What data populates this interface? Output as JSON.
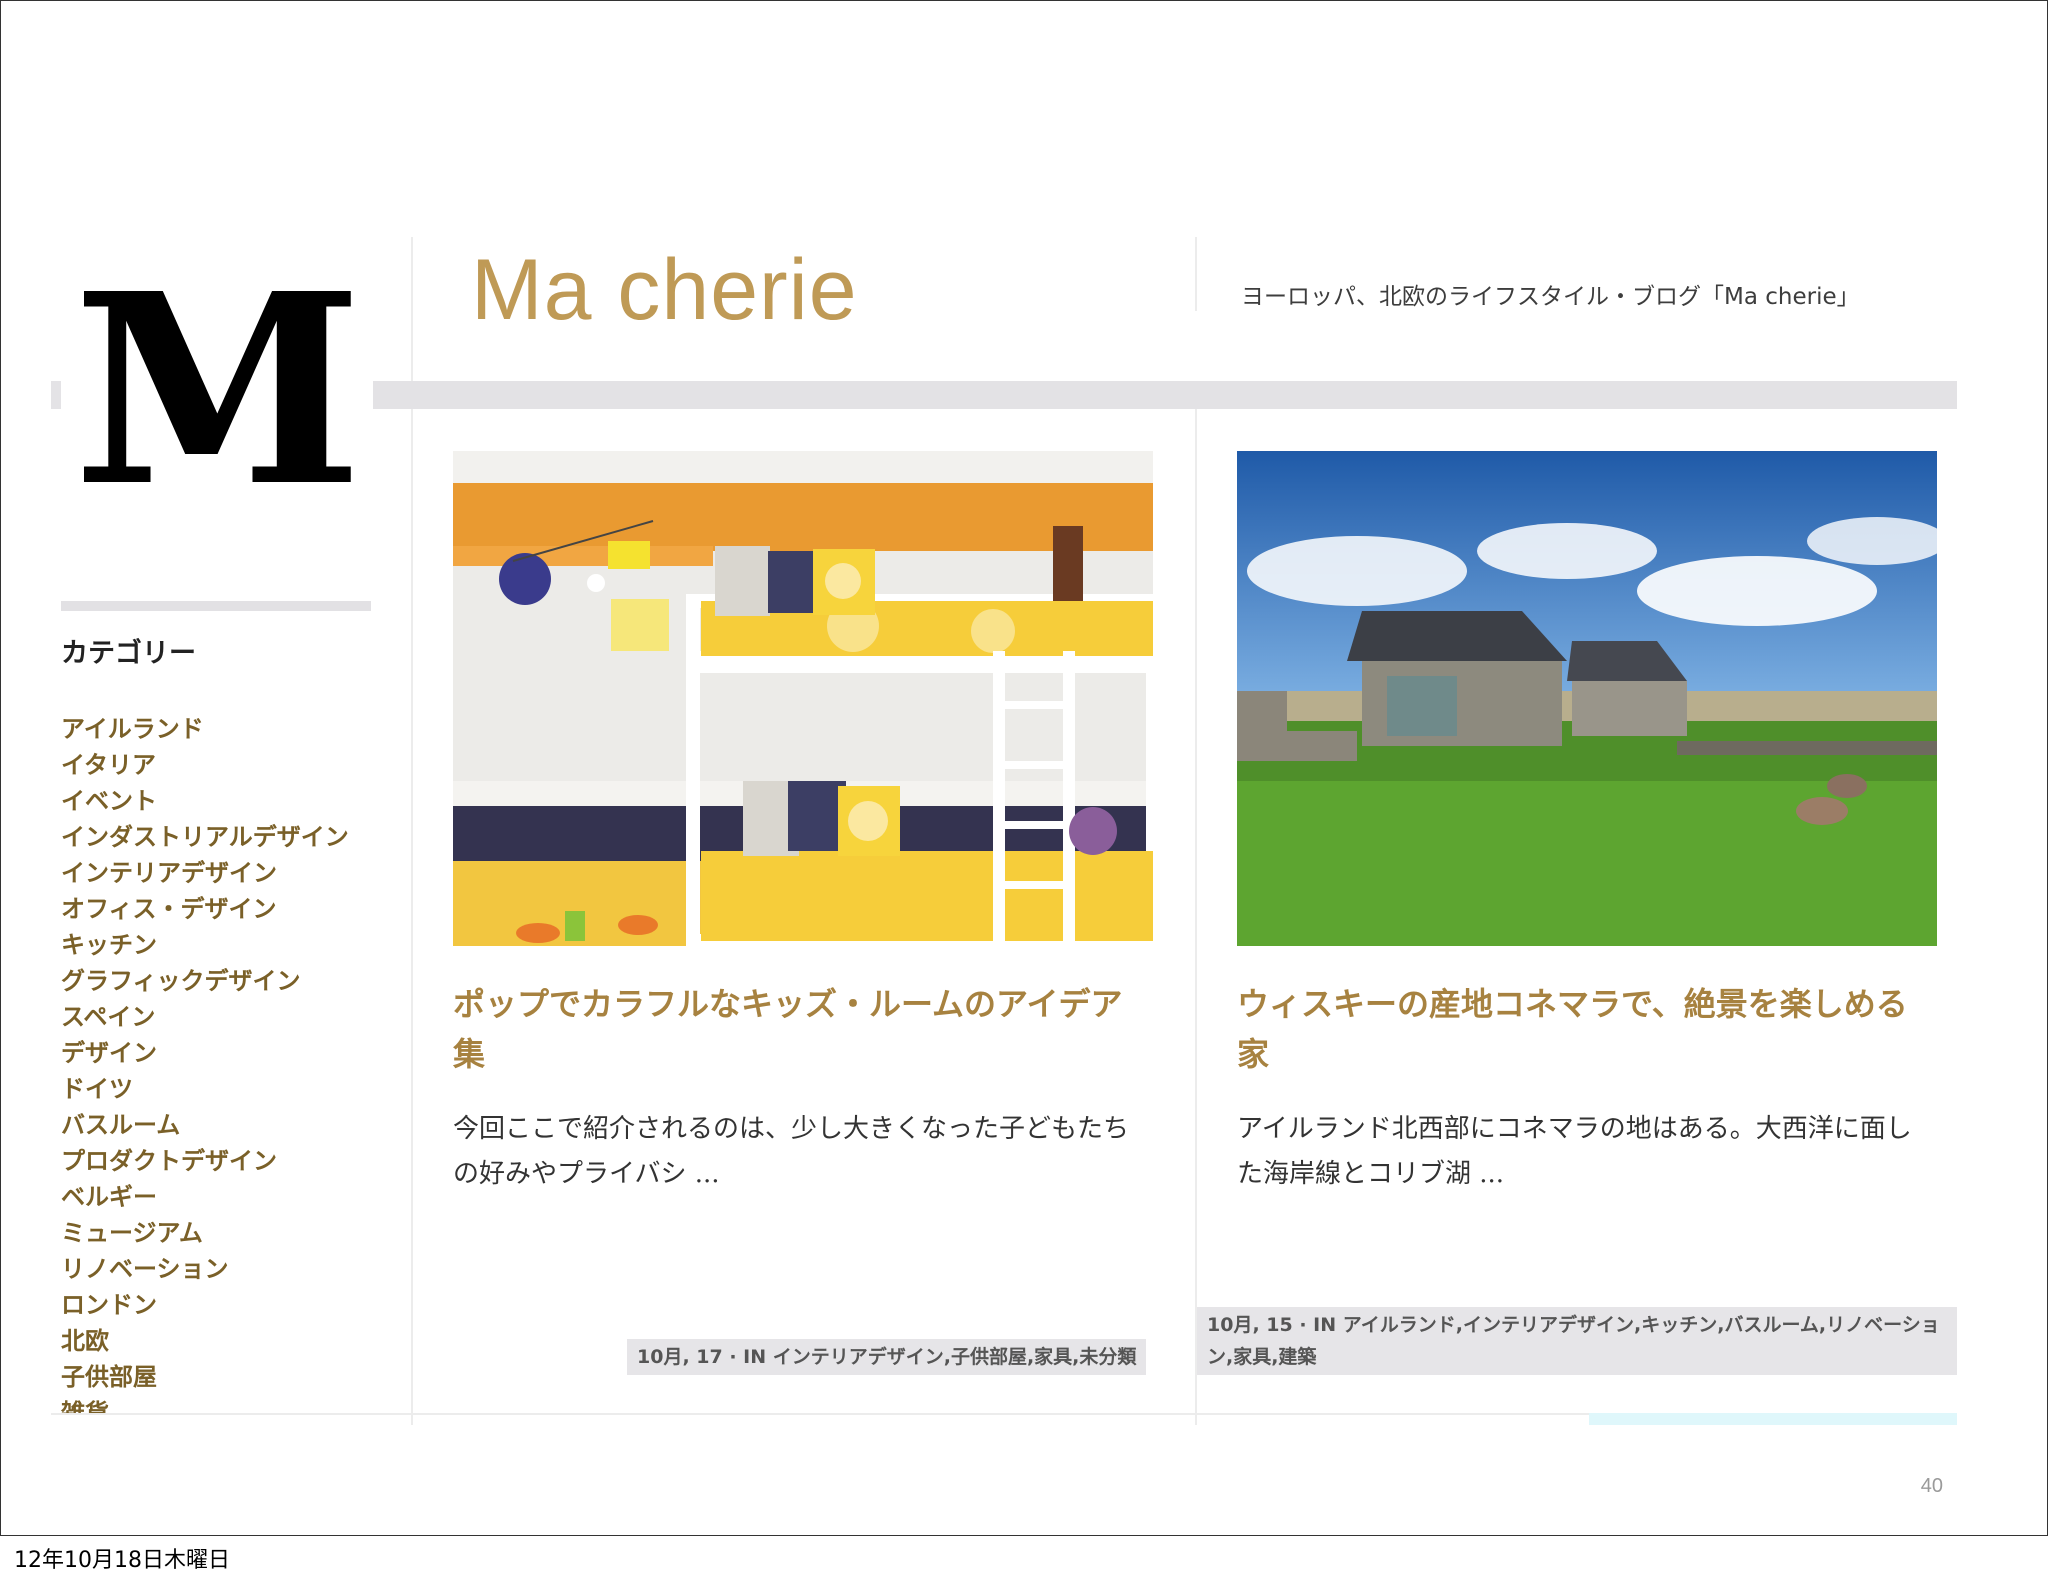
{
  "slide": {
    "page_number": "40",
    "footer_date": "12年10月18日木曜日"
  },
  "blog": {
    "logo_letter": "M",
    "title": "Ma cherie",
    "tagline": "ヨーロッパ、北欧のライフスタイル・ブログ「Ma cherie」"
  },
  "sidebar": {
    "heading": "カテゴリー",
    "categories": [
      "アイルランド",
      "イタリア",
      "イベント",
      "インダストリアルデザイン",
      "インテリアデザイン",
      "オフィス・デザイン",
      "キッチン",
      "グラフィックデザイン",
      "スペイン",
      "デザイン",
      "ドイツ",
      "バスルーム",
      "プロダクトデザイン",
      "ベルギー",
      "ミュージアム",
      "リノベーション",
      "ロンドン",
      "北欧",
      "子供部屋",
      "雑貨"
    ]
  },
  "posts": [
    {
      "title": "ポップでカラフルなキッズ・ルームのアイデア集",
      "excerpt": "今回ここで紹介されるのは、少し大きくなった子どもたちの好みやプライバシ ...",
      "meta": "10月, 17 · IN インテリアデザイン,子供部屋,家具,未分類",
      "image_alt": "kids-bunk-bed-room"
    },
    {
      "title": "ウィスキーの産地コネマラで、絶景を楽しめる家",
      "excerpt": "アイルランド北西部にコネマラの地はある。大西洋に面した海岸線とコリブ湖 ...",
      "meta": "10月, 15 · IN アイルランド,インテリアデザイン,キッチン,バスルーム,リノベーション,家具,建築",
      "image_alt": "stone-house-connemara"
    }
  ],
  "colors": {
    "title_gold": "#bf9a56",
    "post_title": "#a78240",
    "category_link": "#7a6028"
  }
}
